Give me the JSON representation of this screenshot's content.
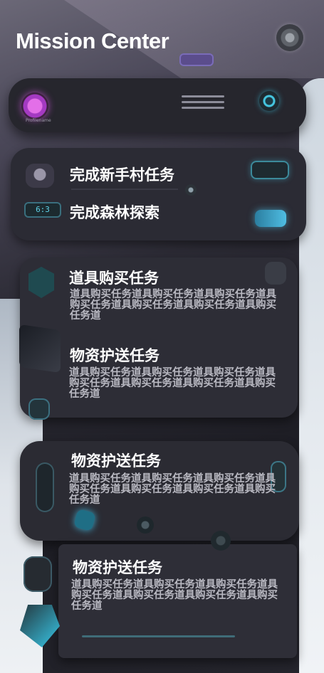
{
  "app": {
    "title": "Mission Center"
  },
  "profile": {
    "caption": "Profilename"
  },
  "tasks": [
    {
      "title": "完成新手村任务"
    },
    {
      "title": "完成森林探索",
      "display_value": "6:3"
    },
    {
      "title": "道具购买任务",
      "desc": "道具购买任务道具购买任务道具购买任务道具购买任务道具购买任务道具购买任务道具购买任务道"
    },
    {
      "title": "物资护送任务",
      "desc": "道具购买任务道具购买任务道具购买任务道具购买任务道具购买任务道具购买任务道具购买任务道"
    },
    {
      "title": "物资护送任务",
      "desc": "道具购买任务道具购买任务道具购买任务道具购买任务道具购买任务道具购买任务道具购买任务道"
    },
    {
      "title": "物资护送任务",
      "desc": "道具购买任务道具购买任务道具购买任务道具购买任务道具购买任务道具购买任务道具购买任务道"
    }
  ],
  "colors": {
    "accent_cyan": "#45c6e0",
    "accent_magenta": "#e36fe8",
    "panel": "#2a2a33"
  }
}
